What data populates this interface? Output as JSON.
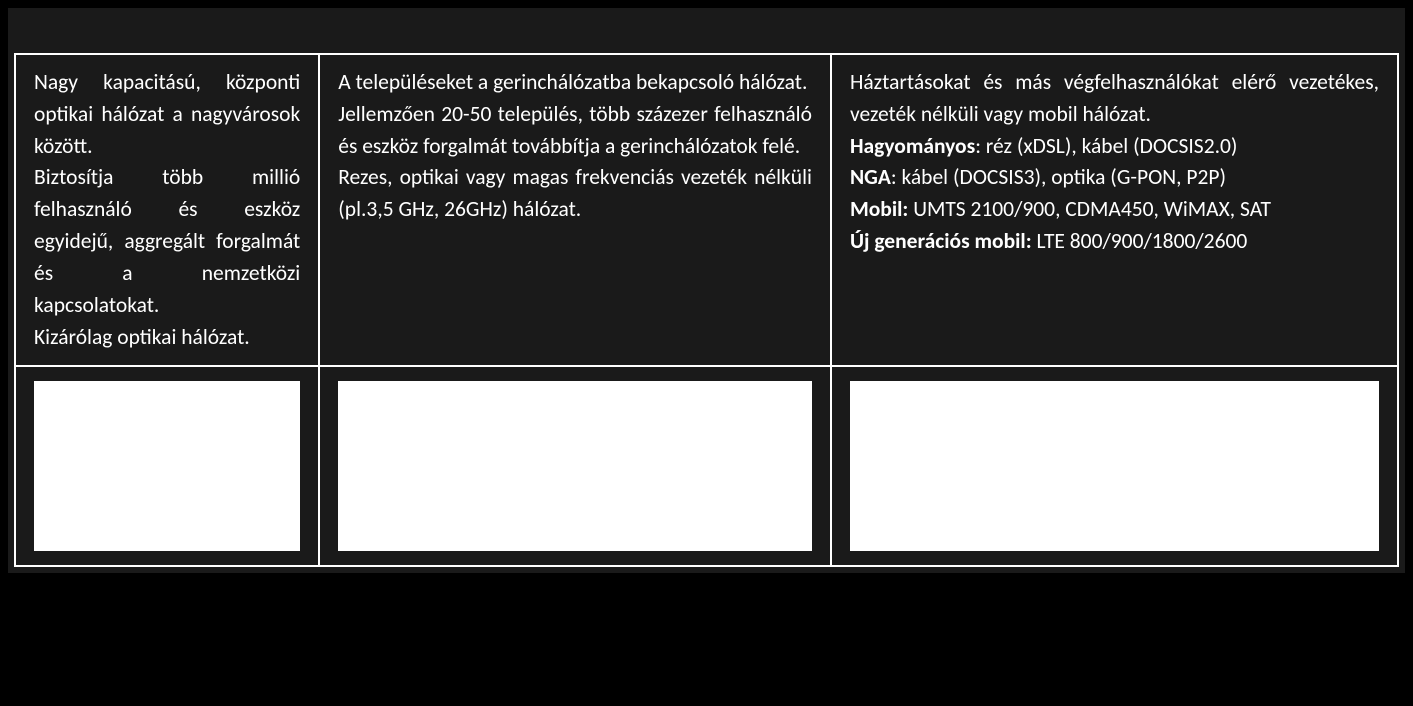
{
  "columns": {
    "c1": {
      "p1": "Nagy kapacitású, központi optikai hálózat a nagyvárosok között.",
      "p2": "Biztosítja több millió felhasználó és eszköz egyidejű, aggregált forgalmát és a nemzetközi kapcsolatokat.",
      "p3": "Kizárólag optikai hálózat."
    },
    "c2": {
      "p1": "A településeket a gerinchálózatba bekapcsoló hálózat.",
      "p2": "Jellemzően 20-50 település, több százezer felhasználó és eszköz forgalmát továbbítja a gerinchálózatok felé.",
      "p3": "Rezes, optikai vagy magas frekvenciás vezeték nélküli (pl.3,5 GHz, 26GHz) hálózat."
    },
    "c3": {
      "p1": "Háztartásokat és más végfelhasználókat elérő vezetékes, vezeték nélküli vagy mobil hálózat.",
      "l1_label": "Hagyományos",
      "l1_rest": ": réz (xDSL), kábel (DOCSIS2.0)",
      "l2_label": "NGA",
      "l2_rest": ": kábel (DOCSIS3), optika (G-PON, P2P)",
      "l3_label": "Mobil:",
      "l3_rest": " UMTS 2100/900, CDMA450, WiMAX, SAT",
      "l4_label": "Új generációs mobil:",
      "l4_rest": " LTE 800/900/1800/2600"
    }
  }
}
